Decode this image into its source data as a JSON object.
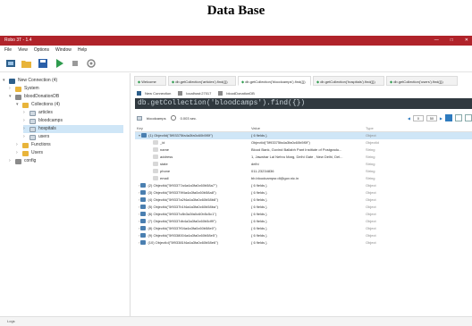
{
  "caption": "Data Base",
  "window": {
    "title": "Robo 3T - 1.4",
    "controls": [
      "—",
      "□",
      "✕"
    ]
  },
  "menu": [
    "File",
    "View",
    "Options",
    "Window",
    "Help"
  ],
  "sidebar": {
    "items": [
      {
        "label": "New Connection (4)",
        "level": 0
      },
      {
        "label": "System",
        "level": 1
      },
      {
        "label": "bloodDonationDB",
        "level": 1
      },
      {
        "label": "Collections (4)",
        "level": 2
      },
      {
        "label": "articles",
        "level": 3
      },
      {
        "label": "bloodcamps",
        "level": 3
      },
      {
        "label": "hospitals",
        "level": 3
      },
      {
        "label": "users",
        "level": 3
      },
      {
        "label": "Functions",
        "level": 2
      },
      {
        "label": "Users",
        "level": 2
      },
      {
        "label": "config",
        "level": 1
      }
    ]
  },
  "tabs": [
    {
      "label": "Welcome",
      "active": false
    },
    {
      "label": "db.getCollection('articles').find({})",
      "active": false
    },
    {
      "label": "db.getCollection('bloodcamps').find({})",
      "active": true
    },
    {
      "label": "db.getCollection('hospitals').find({})",
      "active": false
    },
    {
      "label": "db.getCollection('users').find({})",
      "active": false
    }
  ],
  "connection": {
    "name": "New Connection",
    "host": "localhost:27017",
    "db": "bloodDonationDB"
  },
  "query": "db.getCollection('bloodcamps').find({})",
  "result": {
    "collection": "bloodcamps",
    "time": "0.003 sec.",
    "page_from": "0",
    "page_to": "50"
  },
  "grid": {
    "headers": {
      "key": "Key",
      "value": "Value",
      "type": "Type"
    },
    "rows": [
      {
        "key": "(1) ObjectId(\"5f93375fa4a3fa0c60b5f0f\")",
        "value": "{ 6 fields }",
        "type": "Object",
        "selected": true,
        "depth": 0,
        "expanded": true
      },
      {
        "key": "_id",
        "value": "ObjectId(\"5f93375fa4a3fa0c60b5f0f\")",
        "type": "ObjectId",
        "depth": 1
      },
      {
        "key": "name",
        "value": "Blood Bank, Govind Ballabh Pant Institute of Postgradu...",
        "type": "String",
        "depth": 1
      },
      {
        "key": "address",
        "value": "1, Jawahar Lal Nehru Marg, Delhi Gate , New Delhi, Del...",
        "type": "String",
        "depth": 1
      },
      {
        "key": "state",
        "value": "delhi",
        "type": "String",
        "depth": 1
      },
      {
        "key": "phone",
        "value": "011-23234836",
        "type": "String",
        "depth": 1
      },
      {
        "key": "email",
        "value": "bb.bloodcampsr.dl@gov.nic.in",
        "type": "String",
        "depth": 1
      },
      {
        "key": "(2) ObjectId(\"5f93377a4a4a3fa0c60b58a7\")",
        "value": "{ 6 fields }",
        "type": "Object",
        "depth": 0
      },
      {
        "key": "(3) ObjectId(\"5f93379f4a4a3fa0c60b58a8\")",
        "value": "{ 6 fields }",
        "type": "Object",
        "depth": 0
      },
      {
        "key": "(4) ObjectId(\"5f9337a2f4a4a3fa0c60b58b8\")",
        "value": "{ 6 fields }",
        "type": "Object",
        "depth": 0
      },
      {
        "key": "(5) ObjectId(\"5f9337b1f4a4a3fa0c60b58ba\")",
        "value": "{ 6 fields }",
        "type": "Object",
        "depth": 0
      },
      {
        "key": "(6) ObjectId(\"5f9337c8b3a3fa0c60b5c5c1\")",
        "value": "{ 6 fields }",
        "type": "Object",
        "depth": 0
      },
      {
        "key": "(7) ObjectId(\"5f9337db4a3a3fa0c60b5df9\")",
        "value": "{ 6 fields }",
        "type": "Object",
        "depth": 0
      },
      {
        "key": "(8) ObjectId(\"5f9337f04a4a3fa0c60b58e0\")",
        "value": "{ 6 fields }",
        "type": "Object",
        "depth": 0
      },
      {
        "key": "(9) ObjectId(\"5f9338004a4a3fa0c60b58e5\")",
        "value": "{ 6 fields }",
        "type": "Object",
        "depth": 0
      },
      {
        "key": "(10) ObjectId(\"5f93381f4a4a3fa0c60b58e6\")",
        "value": "{ 6 fields }",
        "type": "Object",
        "depth": 0
      }
    ]
  },
  "statusbar": {
    "text": "Logs"
  },
  "colors": {
    "titlebar": "#b0232a",
    "query_bg": "#30393f",
    "selection": "#cfe6f7",
    "accent": "#2e7bbf"
  }
}
